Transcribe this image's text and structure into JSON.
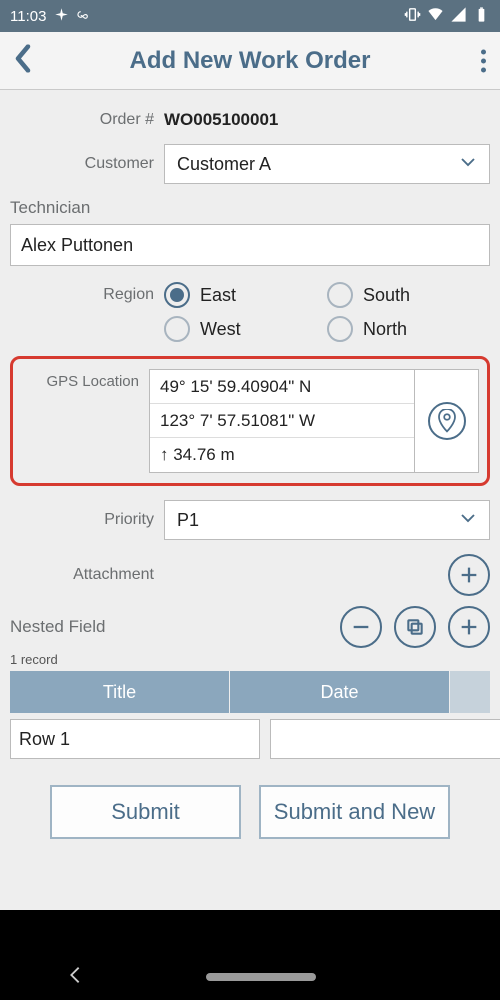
{
  "status": {
    "time": "11:03"
  },
  "header": {
    "title": "Add New Work Order"
  },
  "form": {
    "order_label": "Order #",
    "order_value": "WO005100001",
    "customer_label": "Customer",
    "customer_value": "Customer A",
    "technician_label": "Technician",
    "technician_value": "Alex Puttonen",
    "region_label": "Region",
    "region_options": {
      "east": "East",
      "south": "South",
      "west": "West",
      "north": "North"
    },
    "region_selected": "east",
    "gps_label": "GPS Location",
    "gps": {
      "lat": "49° 15' 59.40904\" N",
      "lon": "123° 7' 57.51081\" W",
      "alt": "↑ 34.76 m"
    },
    "priority_label": "Priority",
    "priority_value": "P1",
    "attachment_label": "Attachment",
    "nested_label": "Nested Field",
    "record_count": "1 record",
    "table": {
      "col_title": "Title",
      "col_date": "Date",
      "row1_title": "Row 1",
      "row1_date": ""
    },
    "buttons": {
      "submit": "Submit",
      "submit_new": "Submit and New"
    }
  }
}
